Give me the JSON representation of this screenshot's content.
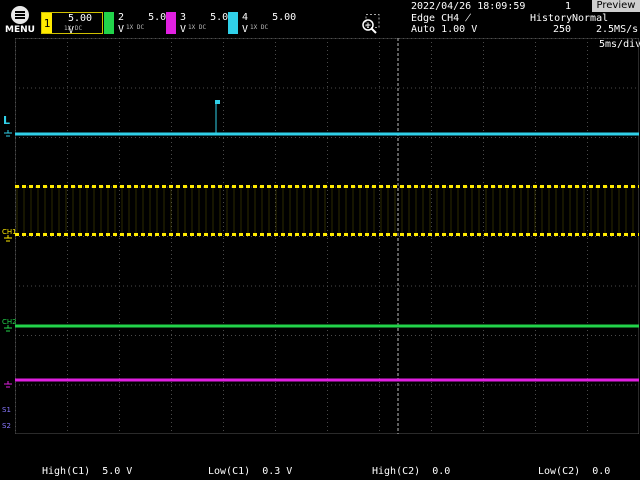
{
  "menu": {
    "label": "MENU",
    "icon": "menu-icon"
  },
  "channels": [
    {
      "id": "ch1",
      "number": "1",
      "scale": "5.00 V",
      "sub": "1X\nDC",
      "color": "#ffea00"
    },
    {
      "id": "ch2",
      "number": "2",
      "scale": "5.00 V",
      "sub": "1X\nDC",
      "color": "#22d34a"
    },
    {
      "id": "ch3",
      "number": "3",
      "scale": "5.00 V",
      "sub": "1X\nDC",
      "color": "#e020e0"
    },
    {
      "id": "ch4",
      "number": "4",
      "scale": "5.00 V",
      "sub": "1X\nDC",
      "color": "#30d0e8"
    }
  ],
  "status": {
    "datetime": "2022/04/26 18:09:59",
    "trigger_edge": "Edge CH4 ̸",
    "trigger_mode": "Auto 1.00 V",
    "acq_count": "1",
    "preview": "Preview",
    "history_label": "History",
    "history_value": "250",
    "acq_mode": "Normal",
    "sample_rate": "2.5MS/s",
    "timebase": "5ms/div"
  },
  "markers": {
    "trigger_level": "L",
    "ch1": "CH1",
    "ch2": "CH2",
    "s1": "S1",
    "s2": "S2"
  },
  "measurements": [
    {
      "label": "High(C1)",
      "value": "5.0 V"
    },
    {
      "label": "Low(C1)",
      "value": "0.3 V"
    },
    {
      "label": "High(C2)",
      "value": "0.0"
    },
    {
      "label": "Low(C2)",
      "value": "0.0"
    }
  ],
  "colors": {
    "grid": "#4a4a4a",
    "cursor": "#bbbbbb",
    "ch1": "#ffea00",
    "ch2": "#22d34a",
    "ch3": "#e020e0",
    "ch4": "#30d0e8",
    "math": "#8878ff"
  }
}
